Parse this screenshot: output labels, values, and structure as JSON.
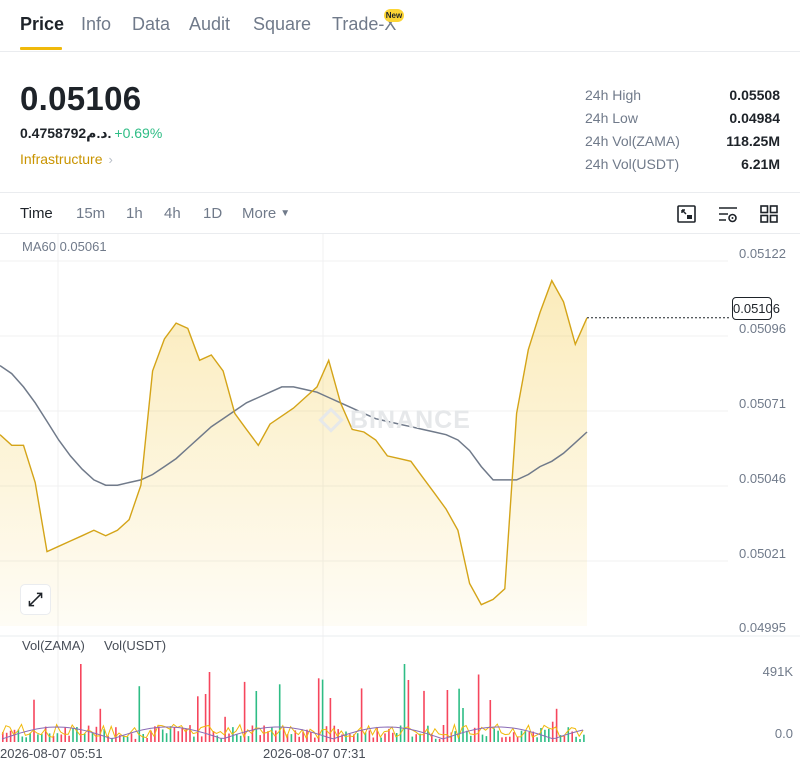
{
  "tabs": [
    {
      "label": "Price",
      "active": true
    },
    {
      "label": "Info"
    },
    {
      "label": "Data"
    },
    {
      "label": "Audit"
    },
    {
      "label": "Square"
    },
    {
      "label": "Trade-X",
      "badge": "New"
    }
  ],
  "price": {
    "last": "0.05106",
    "fiat": "0.4758792م.د.",
    "change": "+0.69%",
    "category": "Infrastructure"
  },
  "stats": [
    {
      "label": "24h High",
      "value": "0.05508"
    },
    {
      "label": "24h Low",
      "value": "0.04984"
    },
    {
      "label": "24h Vol(ZAMA)",
      "value": "118.25M"
    },
    {
      "label": "24h Vol(USDT)",
      "value": "6.21M"
    }
  ],
  "toolbar": {
    "timeframes": [
      {
        "label": "Time",
        "active": true
      },
      {
        "label": "15m"
      },
      {
        "label": "1h"
      },
      {
        "label": "4h"
      },
      {
        "label": "1D"
      },
      {
        "label": "More"
      }
    ]
  },
  "chart": {
    "ma_label": "MA60 0.05061",
    "watermark": "BINANCE",
    "last_price_tag": "0.05106",
    "y_ticks": [
      "0.05122",
      "0.05096",
      "0.05071",
      "0.05046",
      "0.05021",
      "0.04995"
    ],
    "vol_labels": [
      "Vol(ZAMA)",
      "Vol(USDT)"
    ],
    "vol_ticks": [
      "491K",
      "0.0"
    ],
    "time_labels": [
      "2026-08-07 05:51",
      "2026-08-07 07:31"
    ]
  },
  "colors": {
    "accent": "#f0b90b",
    "price_line": "#d4a418",
    "ma_line": "#707a8a",
    "up": "#2ebd85",
    "down": "#f6465d"
  },
  "chart_data": {
    "type": "area",
    "ylim": [
      0.0499,
      0.0513
    ],
    "price": [
      0.05062,
      0.05058,
      0.05058,
      0.05044,
      0.05018,
      0.0502,
      0.05022,
      0.05024,
      0.05026,
      0.05024,
      0.05026,
      0.0503,
      0.05043,
      0.05086,
      0.05098,
      0.05104,
      0.05102,
      0.0509,
      0.05092,
      0.05086,
      0.0507,
      0.05064,
      0.05058,
      0.05066,
      0.05069,
      0.05072,
      0.05076,
      0.0508,
      0.0509,
      0.05074,
      0.05064,
      0.05063,
      0.0506,
      0.05054,
      0.05053,
      0.05052,
      0.05046,
      0.0504,
      0.05034,
      0.05026,
      0.05006,
      0.04998,
      0.05,
      0.05004,
      0.0507,
      0.05094,
      0.05108,
      0.0512,
      0.05112,
      0.05096,
      0.05106
    ],
    "ma60": [
      0.05088,
      0.05085,
      0.0508,
      0.05074,
      0.05067,
      0.0506,
      0.05054,
      0.05049,
      0.05045,
      0.05043,
      0.05043,
      0.05044,
      0.05045,
      0.05047,
      0.0505,
      0.05053,
      0.05057,
      0.05061,
      0.05065,
      0.05068,
      0.05071,
      0.05074,
      0.05076,
      0.05078,
      0.0508,
      0.0508,
      0.05079,
      0.05078,
      0.05076,
      0.05074,
      0.05072,
      0.0507,
      0.05068,
      0.05067,
      0.05066,
      0.05065,
      0.05064,
      0.05063,
      0.05062,
      0.0506,
      0.05056,
      0.0505,
      0.05045,
      0.05045,
      0.05045,
      0.05047,
      0.0505,
      0.05052,
      0.05055,
      0.05059,
      0.05063
    ]
  }
}
